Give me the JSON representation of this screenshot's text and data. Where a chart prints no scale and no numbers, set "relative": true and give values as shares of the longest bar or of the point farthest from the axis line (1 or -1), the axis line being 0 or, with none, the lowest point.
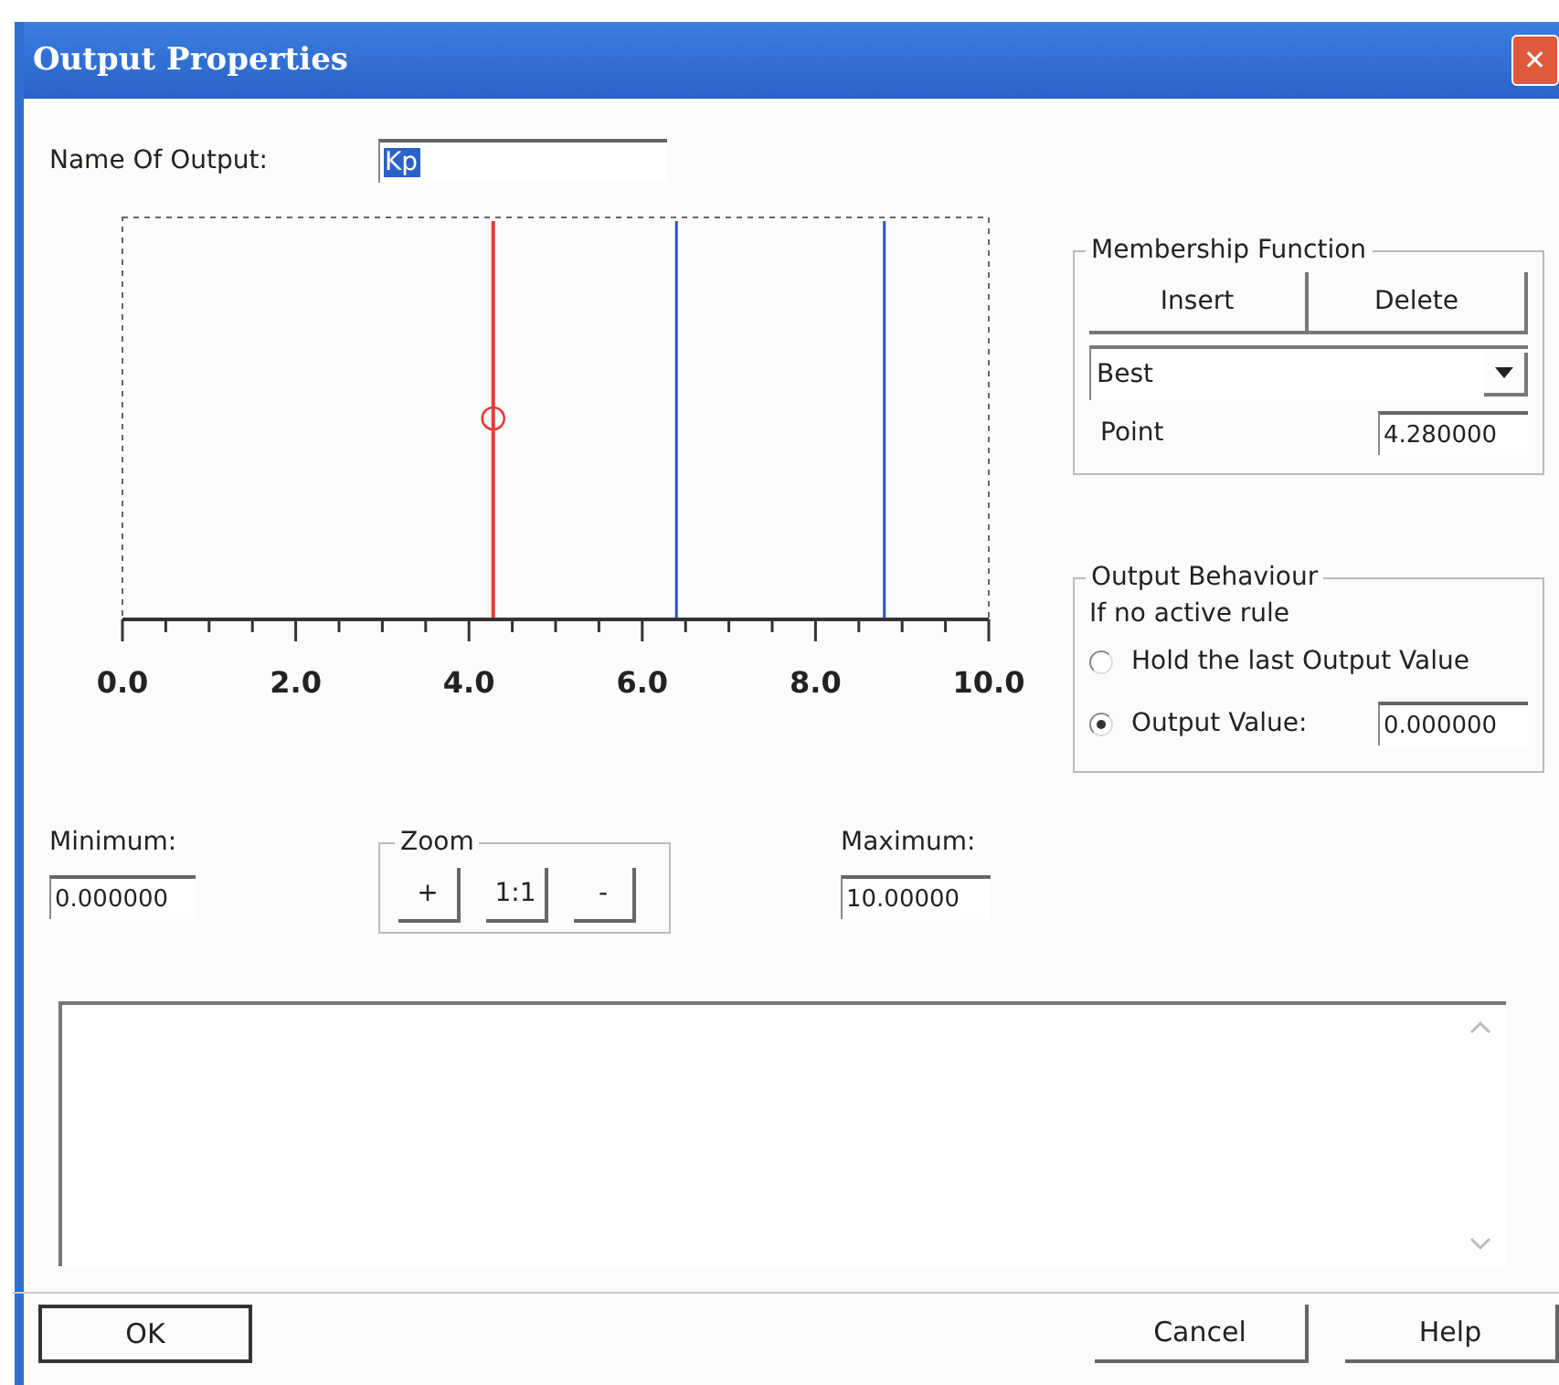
{
  "window": {
    "title": "Output Properties",
    "close_symbol": "✕"
  },
  "name_field": {
    "label": "Name Of Output:",
    "value": "Kp"
  },
  "chart_data": {
    "type": "bar",
    "relative": true,
    "x": [
      4.28,
      6.4,
      8.8
    ],
    "xlim": [
      0,
      10
    ],
    "xticks": [
      {
        "value": 0,
        "label": "0.0"
      },
      {
        "value": 2,
        "label": "2.0"
      },
      {
        "value": 4,
        "label": "4.0"
      },
      {
        "value": 6,
        "label": "6.0"
      },
      {
        "value": 8,
        "label": "8.0"
      },
      {
        "value": 10,
        "label": "10.0"
      }
    ],
    "series": [
      {
        "color": "#e83a3a",
        "values": [
          1,
          null,
          null
        ]
      },
      {
        "color": "#2a52c0",
        "values": [
          null,
          1,
          1
        ]
      }
    ]
  },
  "membership_lines": [
    {
      "selected": true
    },
    {
      "selected": false
    },
    {
      "selected": false
    }
  ],
  "membership": {
    "title": "Membership Function",
    "buttons": [
      "Insert",
      "Delete"
    ],
    "select_value": "Best",
    "point_label": "Point",
    "point_value": "4.280000"
  },
  "behaviour": {
    "title": "Output Behaviour",
    "caption": "If no active rule",
    "options": [
      {
        "label": "Hold the last Output Value",
        "selected": false
      },
      {
        "label": "Output Value:",
        "selected": true,
        "value": "0.000000"
      }
    ]
  },
  "minimum": {
    "label": "Minimum:",
    "value": "0.000000"
  },
  "zoom": {
    "title": "Zoom",
    "buttons": [
      "+",
      "1:1",
      "-"
    ]
  },
  "maximum": {
    "label": "Maximum:",
    "value": "10.00000"
  },
  "buttons": {
    "ok": "OK",
    "cancel": "Cancel",
    "help": "Help"
  }
}
